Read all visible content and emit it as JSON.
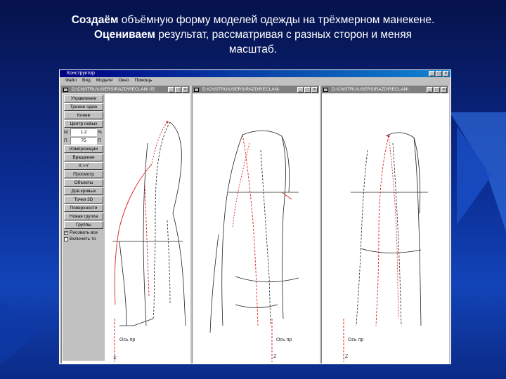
{
  "caption": {
    "line1_bold": "Создаём",
    "line1_rest": " объёмную форму моделей одежды на трёхмерном манекене.",
    "line2_bold": "Оцениваем",
    "line2_rest": " результат, рассматривая с разных сторон и меняя",
    "line3": "масштаб."
  },
  "app": {
    "title": "Конструктор",
    "menu": [
      "Файл",
      "Вид",
      "Модели",
      "Окно",
      "Помощь"
    ]
  },
  "panels": [
    {
      "title": "D:\\CNSTRU\\USERS\\RAZD\\RECLAN\\  05"
    },
    {
      "title": "D:\\CNSTRU\\USERS\\RAZD\\RECLAN\\"
    },
    {
      "title": "D:\\CNSTRU\\USERS\\RAZD\\RECLAN\\"
    }
  ],
  "tools": {
    "buttons": [
      "Управление",
      "Трение одеж",
      "Клеев",
      "Центр новых",
      "Измпроекции",
      "Вращение",
      "X->Y",
      "Просмотр",
      "Объекты",
      "Дов.кривых",
      "Точки 3D",
      "Поверхности",
      "Новая группа",
      "Группы"
    ],
    "field1_label": "Ш",
    "field1_value": "1.2",
    "field1_unit": "%",
    "field2_label": "П",
    "field2_value": "75",
    "field2_unit": "П",
    "checkbox1_label": "Рисовать все",
    "checkbox1_checked": true,
    "checkbox2_label": "Включить то",
    "checkbox2_checked": false
  },
  "axes": {
    "axis_label_1": "Ось пр",
    "axis_label_2": "Ось пр",
    "axis_label_3": "Ось пр",
    "z_label": "Z",
    "x_label": "X"
  },
  "colors": {
    "background": "#0a2a8e",
    "accent_red": "#e02020",
    "line_dark": "#202020"
  }
}
